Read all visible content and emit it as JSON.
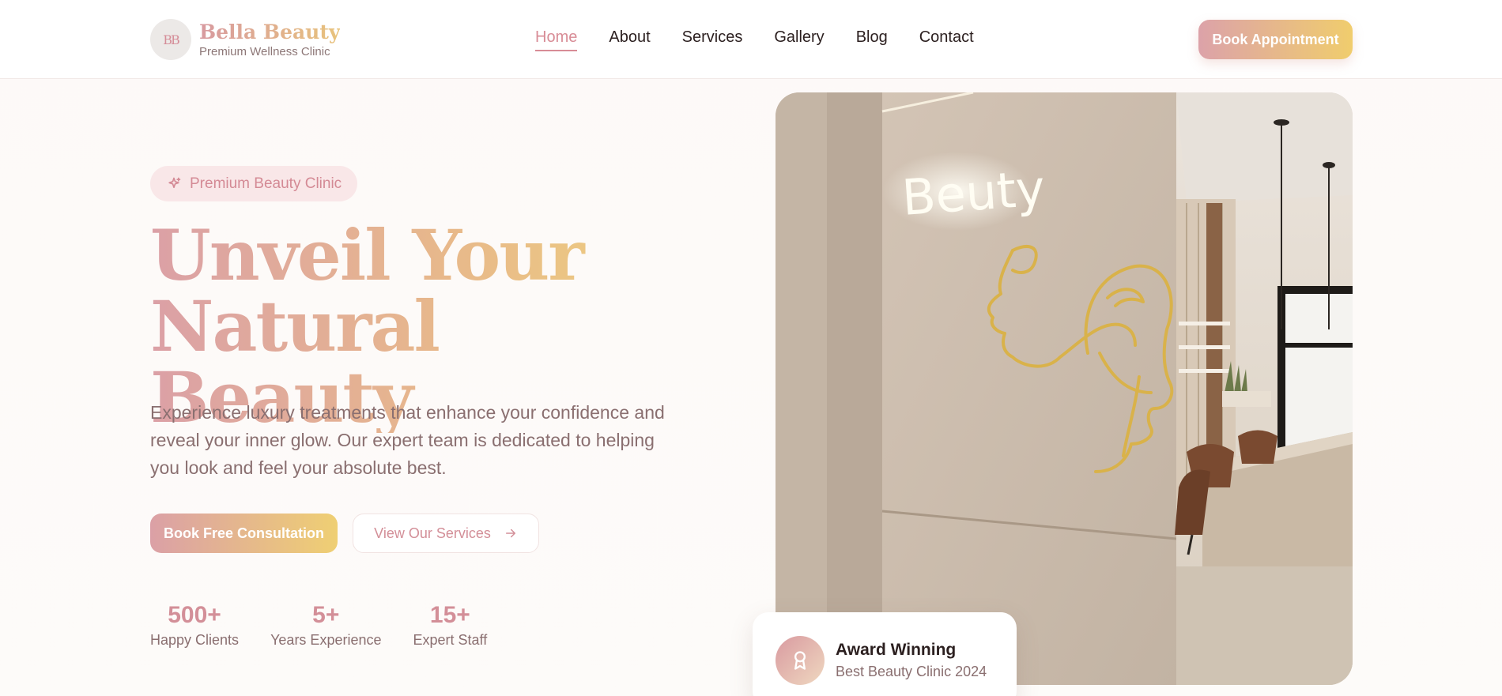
{
  "header": {
    "brand_mark": "BB",
    "brand_name": "Bella Beauty",
    "brand_tagline": "Premium Wellness Clinic",
    "nav": [
      {
        "label": "Home",
        "active": true
      },
      {
        "label": "About",
        "active": false
      },
      {
        "label": "Services",
        "active": false
      },
      {
        "label": "Gallery",
        "active": false
      },
      {
        "label": "Blog",
        "active": false
      },
      {
        "label": "Contact",
        "active": false
      }
    ],
    "book_button": "Book Appointment"
  },
  "hero": {
    "badge": {
      "label": "Premium Beauty Clinic",
      "icon": "sparkle-icon"
    },
    "title_line1": "Unveil Your",
    "title_line2": "Natural Beauty",
    "description": "Experience luxury treatments that enhance your confidence and reveal your inner glow. Our expert team is dedicated to helping you look and feel your absolute best.",
    "primary_cta": "Book Free Consultation",
    "secondary_cta": "View Our Services",
    "secondary_cta_icon": "arrow-right-icon",
    "stats": [
      {
        "value": "500+",
        "label": "Happy Clients"
      },
      {
        "value": "5+",
        "label": "Years Experience"
      },
      {
        "value": "15+",
        "label": "Expert Staff"
      }
    ],
    "image_sign": "Beuty",
    "award": {
      "title": "Award Winning",
      "subtitle": "Best Beauty Clinic 2024",
      "icon": "award-icon"
    }
  },
  "colors": {
    "accent_pink": "#d88c96",
    "accent_gold": "#efcf73",
    "text_muted": "#8a6f70"
  }
}
